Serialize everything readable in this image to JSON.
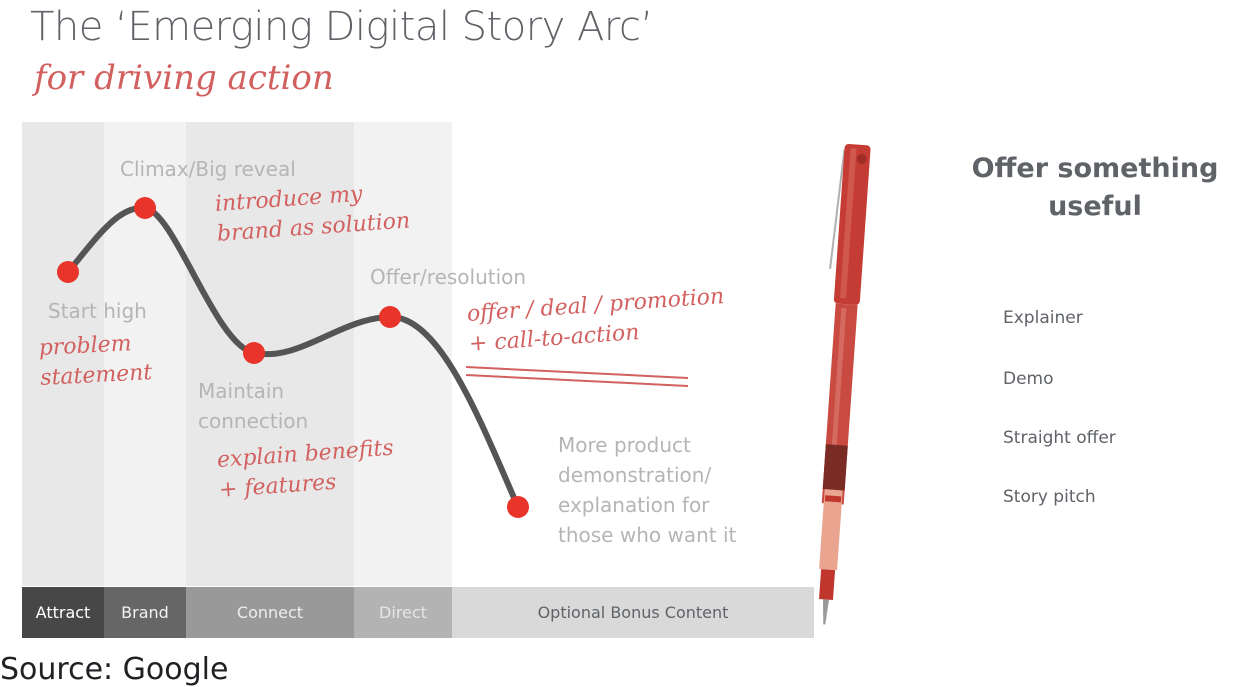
{
  "slide": {
    "title": "The ‘Emerging Digital Story Arc’",
    "subtitle": "for driving action",
    "source_caption": "Source: Google"
  },
  "arc": {
    "stages": [
      {
        "label": "Attract",
        "bar_color": "#474747",
        "text_color": "#ffffff",
        "column_color": "#e8e8e8"
      },
      {
        "label": "Brand",
        "bar_color": "#666666",
        "text_color": "#f2f2f2",
        "column_color": "#f2f2f2"
      },
      {
        "label": "Connect",
        "bar_color": "#999999",
        "text_color": "#eeeeee",
        "column_color": "#e8e8e8"
      },
      {
        "label": "Direct",
        "bar_color": "#b3b3b3",
        "text_color": "#e6e6e6",
        "column_color": "#f2f2f2"
      },
      {
        "label": "Optional Bonus Content",
        "bar_color": "#d9d9d9",
        "text_color": "#5f6368",
        "column_color": "#ffffff"
      }
    ],
    "points": [
      {
        "label": "Start high",
        "note_lines": [
          "problem",
          "statement"
        ]
      },
      {
        "label": "Climax/Big reveal",
        "note_lines": [
          "introduce my",
          "brand as solution"
        ]
      },
      {
        "label_lines": [
          "Maintain",
          "connection"
        ],
        "note_lines": [
          "explain benefits",
          "+ features"
        ]
      },
      {
        "label": "Offer/resolution",
        "note_lines": [
          "offer / deal / promotion",
          "+ call-to-action"
        ]
      },
      {
        "label_lines": [
          "More product",
          "demonstration/",
          "explanation for",
          "those who want it"
        ]
      }
    ],
    "colors": {
      "point": "#e8342a",
      "curve": "#555555",
      "handwriting": "#d2605f"
    }
  },
  "sidebar": {
    "title_lines": [
      "Offer something",
      "useful"
    ],
    "items": [
      "Explainer",
      "Demo",
      "Straight offer",
      "Story pitch"
    ]
  }
}
